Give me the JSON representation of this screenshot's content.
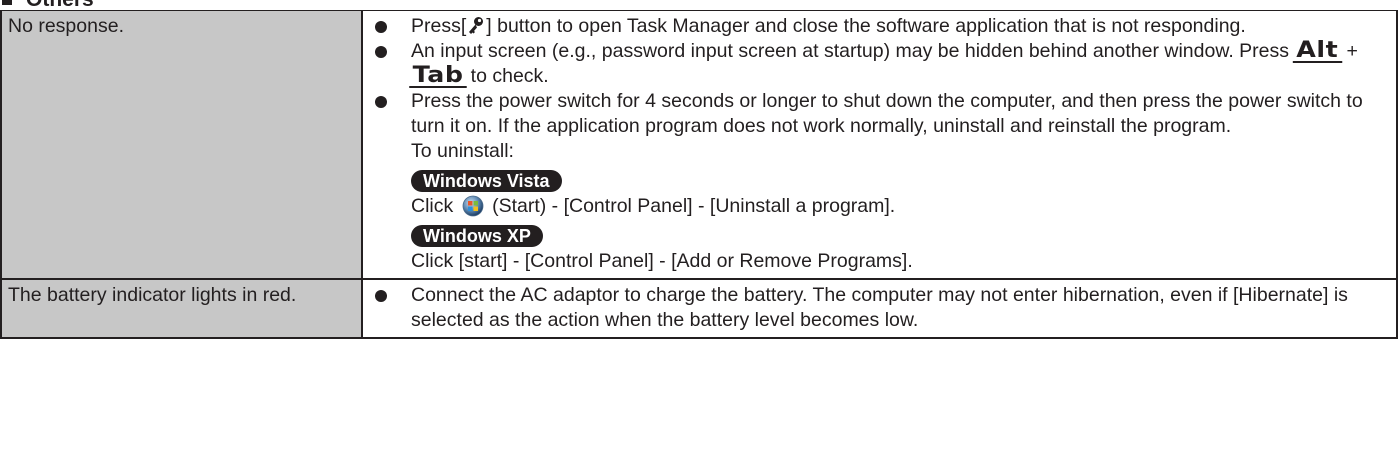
{
  "section": {
    "title": "Others"
  },
  "rows": [
    {
      "problem": "No response.",
      "solutions": {
        "s1_pre": "Press[",
        "s1_icon": "wrench-key-icon",
        "s1_post": "] button to open Task Manager and close the software application that is not responding.",
        "s2_pre": "An input screen (e.g., password input screen at startup) may be hidden behind another window. Press ",
        "s2_key1": "Alt",
        "s2_plus": " + ",
        "s2_key2": "Tab",
        "s2_post": " to check.",
        "s3_text": "Press the power switch for 4 seconds or longer to shut down the computer, and then press the power switch to turn it on. If the application program does not work normally, uninstall and reinstall the program.",
        "s3_uninstall": "To uninstall:",
        "vista_badge": "Windows Vista",
        "vista_pre": "Click ",
        "vista_icon": "windows-start-orb-icon",
        "vista_post": " (Start) - [Control Panel] - [Uninstall a program].",
        "xp_badge": "Windows XP",
        "xp_text": "Click [start] - [Control Panel] - [Add or Remove Programs]."
      }
    },
    {
      "problem": "The battery indicator lights in red.",
      "solutions": {
        "s1_text": "Connect the AC adaptor to charge the battery. The computer may not enter hibernation, even if [Hibernate] is selected as the action when the battery level becomes low."
      }
    }
  ]
}
